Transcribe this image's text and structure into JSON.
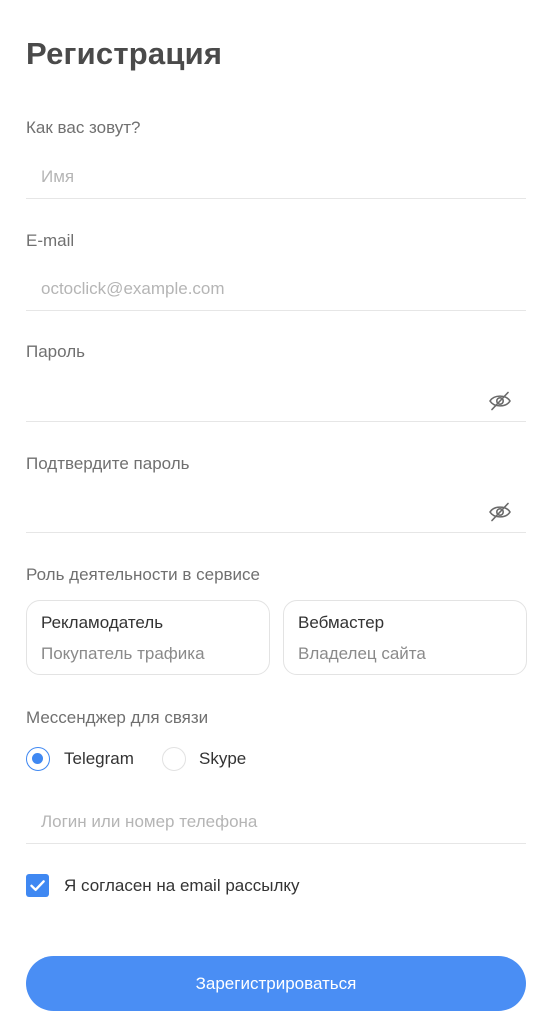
{
  "title": "Регистрация",
  "name": {
    "label": "Как вас зовут?",
    "placeholder": "Имя",
    "value": ""
  },
  "email": {
    "label": "E-mail",
    "placeholder": "octoclick@example.com",
    "value": ""
  },
  "password": {
    "label": "Пароль",
    "placeholder": "",
    "value": "",
    "icon": "eye-off-icon"
  },
  "confirm_password": {
    "label": "Подтвердите пароль",
    "placeholder": "",
    "value": "",
    "icon": "eye-off-icon"
  },
  "role": {
    "label": "Роль деятельности в сервисе",
    "options": [
      {
        "title": "Рекламодатель",
        "subtitle": "Покупатель трафика"
      },
      {
        "title": "Вебмастер",
        "subtitle": "Владелец сайта"
      }
    ]
  },
  "messenger": {
    "label": "Мессенджер для связи",
    "options": [
      {
        "label": "Telegram",
        "selected": true
      },
      {
        "label": "Skype",
        "selected": false
      }
    ],
    "login_placeholder": "Логин или номер телефона",
    "login_value": ""
  },
  "consent": {
    "label": "Я согласен на email рассылку",
    "checked": true
  },
  "submit_label": "Зарегистрироваться",
  "colors": {
    "accent": "#3f88f2",
    "button": "#4a8ef4",
    "title": "#4a4a4a"
  }
}
